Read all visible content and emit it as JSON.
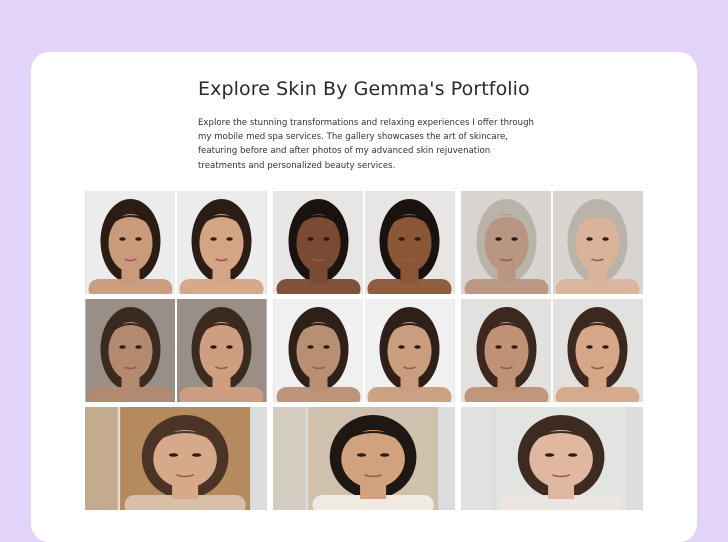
{
  "section": {
    "title": "Explore Skin By Gemma's Portfolio",
    "description": "Explore the stunning transformations and relaxing experiences I offer through my mobile med spa services. The gallery showcases the art of skincare, featuring before and after photos of my advanced skin rejuvenation treatments and personalized beauty services."
  },
  "gallery": {
    "tiles": [
      {
        "kind": "before-after",
        "skin": "#c99a7c",
        "skin2": "#d4a584",
        "hair": "#2b1d16",
        "bg": "#ececec"
      },
      {
        "kind": "before-after",
        "skin": "#7a4a33",
        "skin2": "#8b5538",
        "hair": "#1a120e",
        "bg": "#e8e6e4"
      },
      {
        "kind": "before-after",
        "skin": "#b99682",
        "skin2": "#d9b49a",
        "hair": "#b9b3aa",
        "bg": "#d8d5d0"
      },
      {
        "kind": "before-after",
        "skin": "#b38a70",
        "skin2": "#cf9e80",
        "hair": "#3a2a20",
        "bg": "#9a8f86"
      },
      {
        "kind": "before-after",
        "skin": "#b98f73",
        "skin2": "#c99d7e",
        "hair": "#2e2019",
        "bg": "#f0f0f0"
      },
      {
        "kind": "before-after",
        "skin": "#bf9275",
        "skin2": "#d5a688",
        "hair": "#3b281f",
        "bg": "#e3e1df"
      },
      {
        "kind": "single",
        "skin": "#d6a98a",
        "hair": "#4b3425",
        "bg": "#b48a5e",
        "top": "#d8c2ad"
      },
      {
        "kind": "single",
        "skin": "#d2a27e",
        "hair": "#1e1713",
        "bg": "#cfc1ad",
        "top": "#f2ece6"
      },
      {
        "kind": "single",
        "skin": "#e0b8a0",
        "hair": "#3d2a20",
        "bg": "#e2e4e2",
        "top": "#ede6df"
      }
    ]
  }
}
